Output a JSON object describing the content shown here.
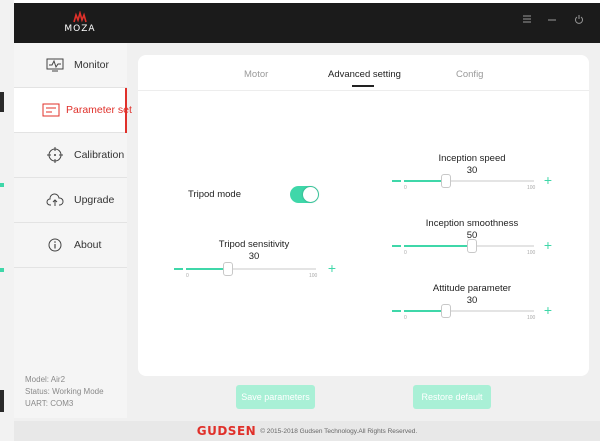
{
  "app": {
    "logo_text": "MOZA",
    "window_controls": {
      "menu_icon": "menu-icon",
      "minimize_icon": "minimize-icon",
      "power_icon": "power-icon"
    }
  },
  "sidebar": {
    "items": [
      {
        "label": "Monitor",
        "icon": "monitor-icon",
        "active": false
      },
      {
        "label": "Parameter set",
        "icon": "parameter-icon",
        "active": true
      },
      {
        "label": "Calibration",
        "icon": "calibration-icon",
        "active": false
      },
      {
        "label": "Upgrade",
        "icon": "cloud-upload-icon",
        "active": false
      },
      {
        "label": "About",
        "icon": "info-icon",
        "active": false
      }
    ],
    "status": {
      "model": "Model: Air2",
      "status": "Status: Working Mode",
      "uart": "UART: COM3"
    }
  },
  "tabs": [
    {
      "label": "Motor",
      "active": false
    },
    {
      "label": "Advanced setting",
      "active": true
    },
    {
      "label": "Config",
      "active": false
    }
  ],
  "settings": {
    "tripod_mode": {
      "label": "Tripod mode",
      "on": true
    },
    "tripod_sensitivity": {
      "label": "Tripod sensitivity",
      "value": "30",
      "min": "0",
      "max": "100"
    },
    "inception_speed": {
      "label": "Inception speed",
      "value": "30",
      "min": "0",
      "max": "100"
    },
    "inception_smoothness": {
      "label": "Inception smoothness",
      "value": "50",
      "min": "0",
      "max": "100"
    },
    "attitude_parameter": {
      "label": "Attitude parameter",
      "value": "30",
      "min": "0",
      "max": "100"
    }
  },
  "buttons": {
    "save": "Save parameters",
    "restore": "Restore default"
  },
  "footer": {
    "brand": "GUDSEN",
    "copyright": "© 2015-2018 Gudsen Technology.All Rights Reserved."
  },
  "colors": {
    "accent": "#3fd7a9",
    "active_nav": "#e0302a",
    "titlebar": "#1b1b1b"
  }
}
